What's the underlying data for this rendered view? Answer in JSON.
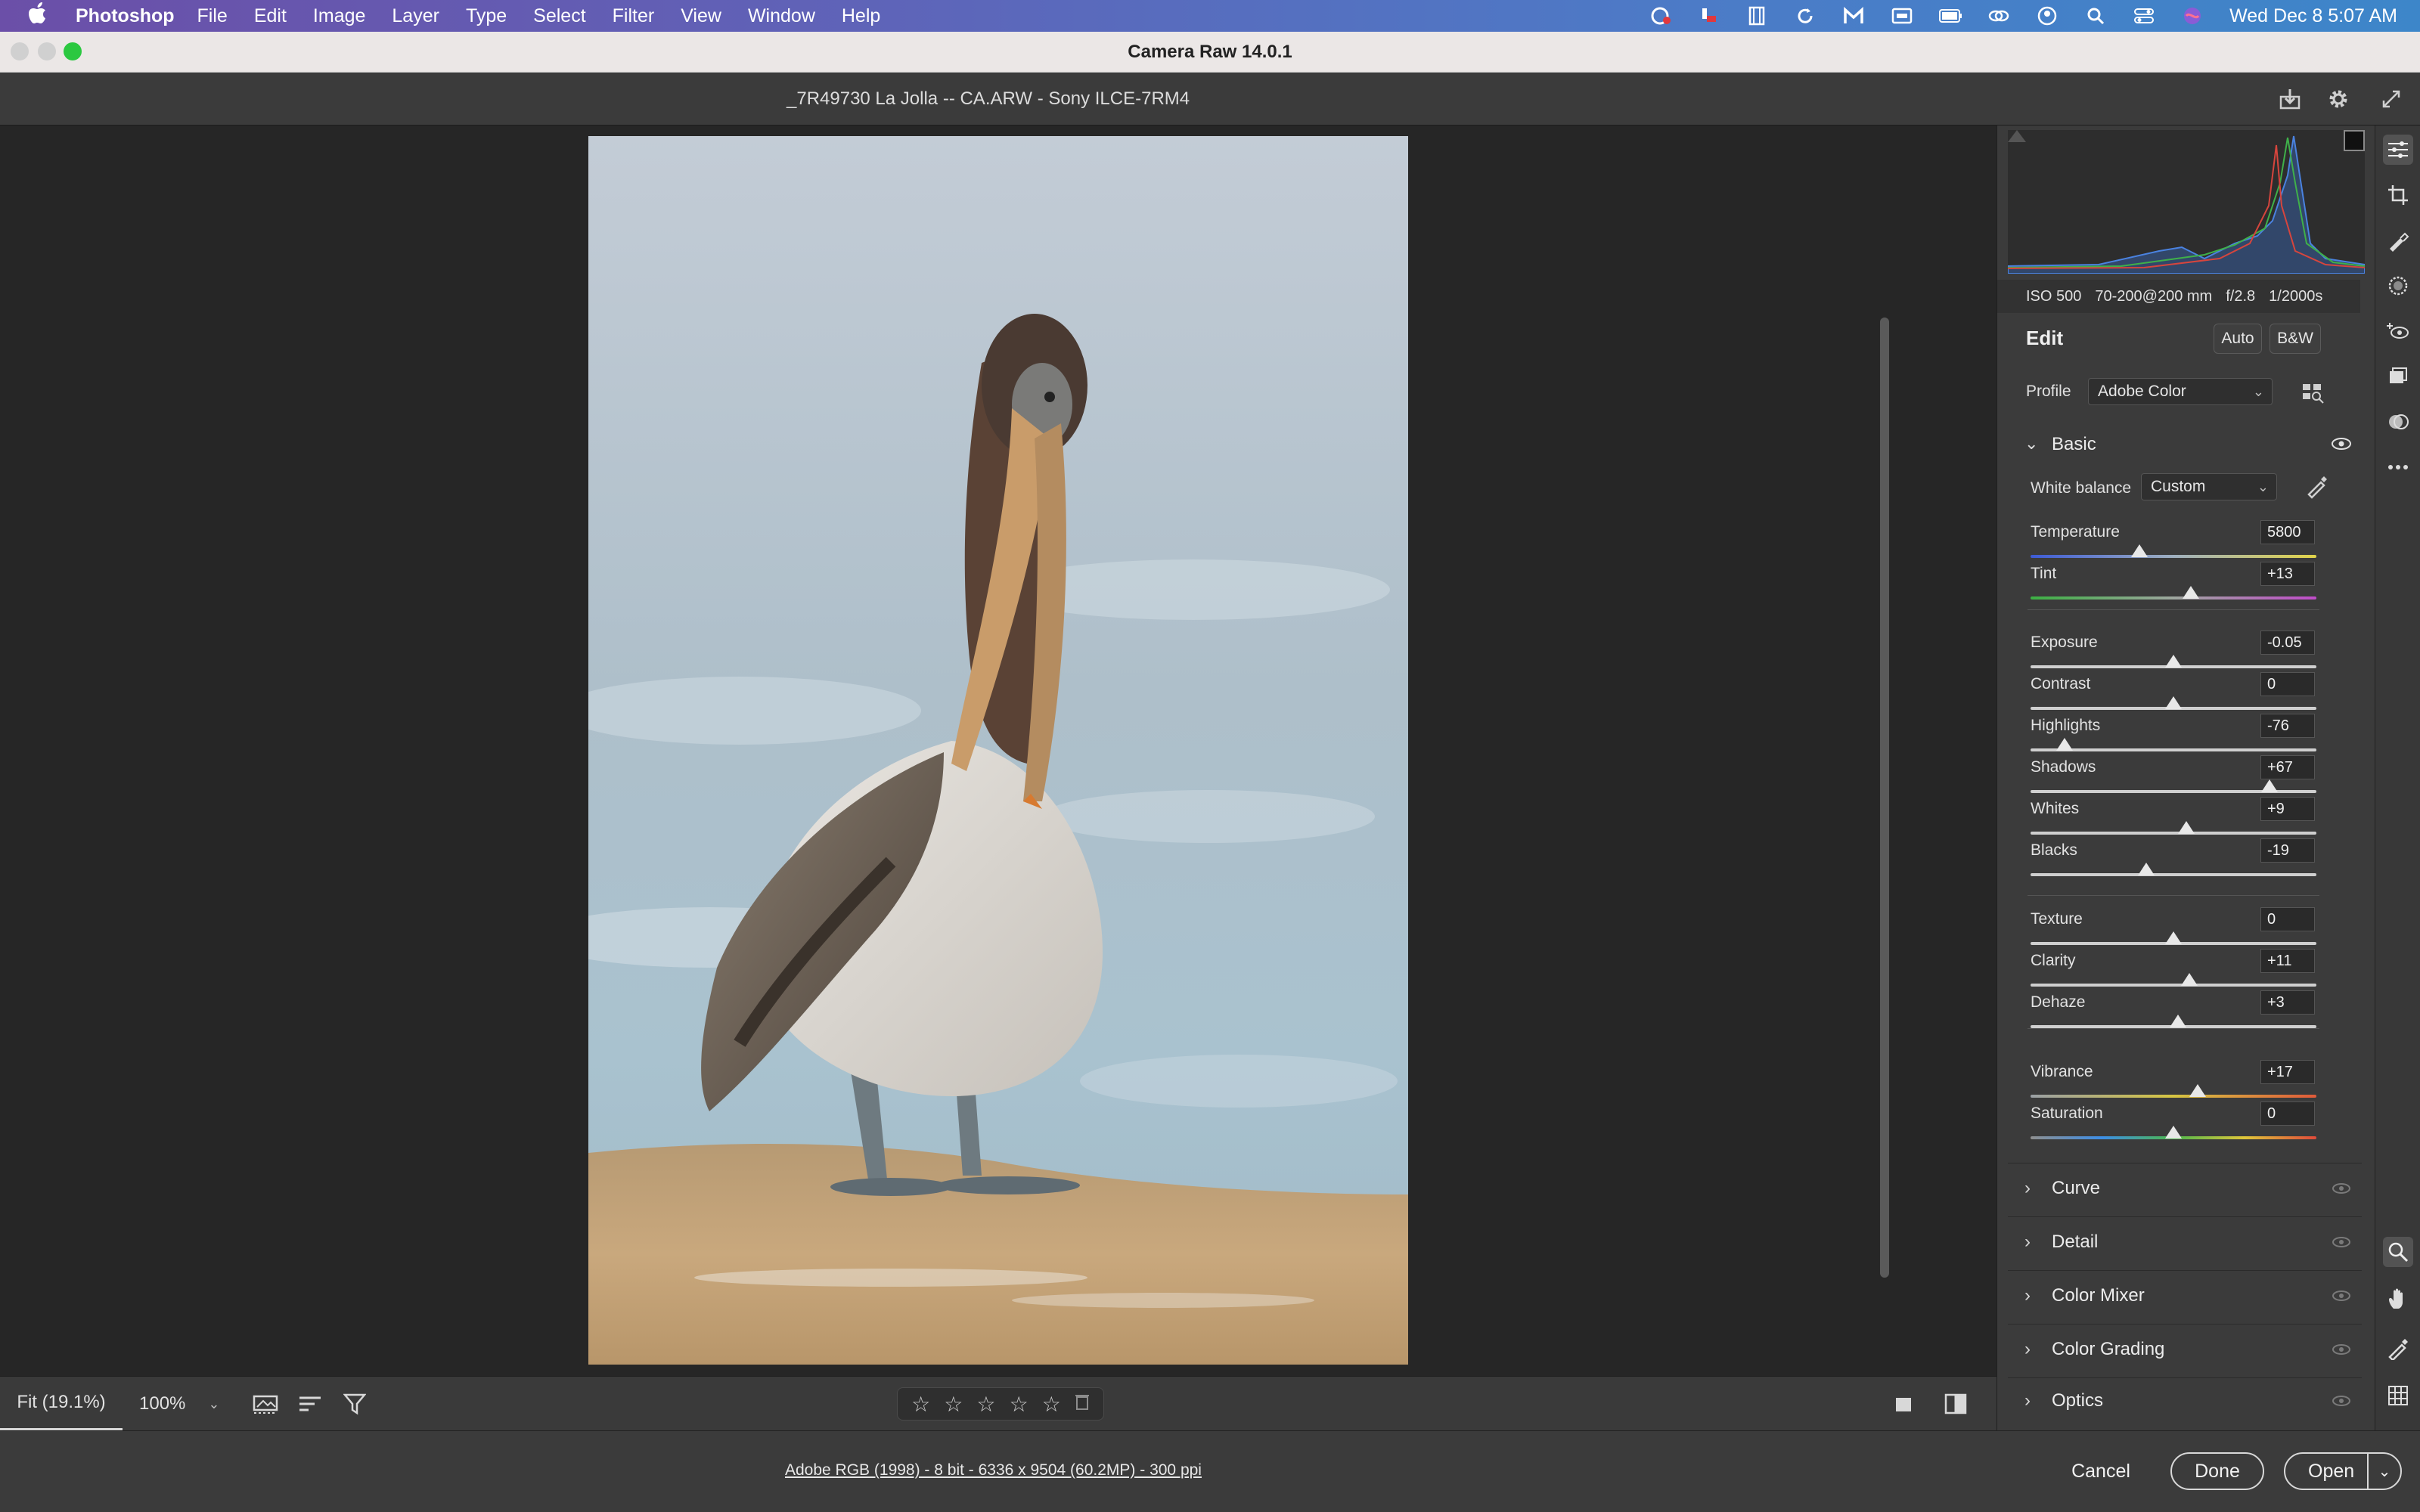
{
  "menubar": {
    "app": "Photoshop",
    "menus": [
      "File",
      "Edit",
      "Image",
      "Layer",
      "Type",
      "Select",
      "Filter",
      "View",
      "Window",
      "Help"
    ],
    "datetime": "Wed Dec 8  5:07 AM"
  },
  "window": {
    "title": "Camera Raw 14.0.1"
  },
  "file": {
    "name": "_7R49730 La  Jolla --  CA.ARW  -  Sony ILCE-7RM4"
  },
  "exif": {
    "iso": "ISO 500",
    "lens": "70-200@200 mm",
    "aperture": "f/2.8",
    "shutter": "1/2000s"
  },
  "edit": {
    "heading": "Edit",
    "auto": "Auto",
    "bw": "B&W",
    "profile_label": "Profile",
    "profile_value": "Adobe Color",
    "basic_title": "Basic",
    "wb_label": "White balance",
    "wb_value": "Custom"
  },
  "sliders": {
    "temperature": {
      "label": "Temperature",
      "value": "5800",
      "position": 0.38
    },
    "tint": {
      "label": "Tint",
      "value": "+13",
      "position": 0.56
    },
    "exposure": {
      "label": "Exposure",
      "value": "-0.05",
      "position": 0.5
    },
    "contrast": {
      "label": "Contrast",
      "value": "0",
      "position": 0.5
    },
    "highlights": {
      "label": "Highlights",
      "value": "-76",
      "position": 0.12
    },
    "shadows": {
      "label": "Shadows",
      "value": "+67",
      "position": 0.835
    },
    "whites": {
      "label": "Whites",
      "value": "+9",
      "position": 0.545
    },
    "blacks": {
      "label": "Blacks",
      "value": "-19",
      "position": 0.405
    },
    "texture": {
      "label": "Texture",
      "value": "0",
      "position": 0.5
    },
    "clarity": {
      "label": "Clarity",
      "value": "+11",
      "position": 0.555
    },
    "dehaze": {
      "label": "Dehaze",
      "value": "+3",
      "position": 0.515
    },
    "vibrance": {
      "label": "Vibrance",
      "value": "+17",
      "position": 0.585
    },
    "saturation": {
      "label": "Saturation",
      "value": "0",
      "position": 0.5
    }
  },
  "sections": [
    "Curve",
    "Detail",
    "Color Mixer",
    "Color Grading",
    "Optics"
  ],
  "toolbar": {
    "fit": "Fit (19.1%)",
    "zoom": "100%"
  },
  "rating": {
    "stars": 0,
    "max": 5
  },
  "footer": {
    "workflow": "Adobe RGB (1998) - 8 bit - 6336 x 9504 (60.2MP) - 300 ppi",
    "cancel": "Cancel",
    "done": "Done",
    "open": "Open"
  },
  "colors": {
    "accent": "#e6e6e6",
    "panel": "#3b3b3b",
    "canvas": "#262626"
  }
}
